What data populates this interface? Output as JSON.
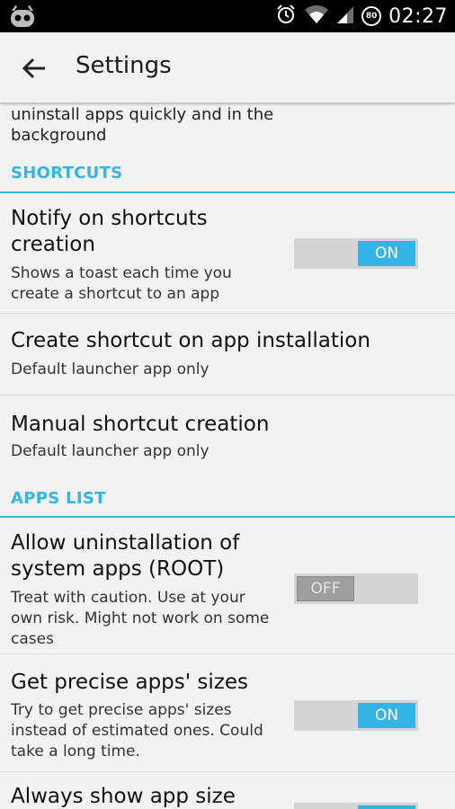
{
  "status_bar": {
    "time": "02:27",
    "battery_level": "80",
    "icons": [
      "android-head-icon",
      "alarm-icon",
      "wifi-icon",
      "signal-icon",
      "battery-circle-icon"
    ]
  },
  "action_bar": {
    "title": "Settings",
    "back_icon": "arrow-back-icon"
  },
  "top_summary": "uninstall apps quickly and in the background",
  "sections": {
    "shortcuts": "SHORTCUTS",
    "apps_list": "APPS LIST"
  },
  "prefs": {
    "notify": {
      "title": "Notify on shortcuts creation",
      "summary": "Shows a toast each time you create a shortcut to an app",
      "switch_label": "ON",
      "state": "on"
    },
    "create_on_install": {
      "title": "Create shortcut on app installation",
      "summary": "Default launcher app only"
    },
    "manual": {
      "title": "Manual shortcut creation",
      "summary": "Default launcher app only"
    },
    "uninstall_system": {
      "title": "Allow uninstallation of system apps (ROOT)",
      "summary": "Treat with caution. Use at your own risk. Might not work on some cases",
      "switch_label": "OFF",
      "state": "off"
    },
    "precise_sizes": {
      "title": "Get precise apps' sizes",
      "summary": "Try to get precise apps' sizes instead of estimated ones. Could take a long time.",
      "switch_label": "ON",
      "state": "on"
    },
    "always_show_size": {
      "title": "Always show app size",
      "state": "on"
    }
  },
  "colors": {
    "accent": "#33b5e5",
    "background": "#f2f2f2",
    "status_bar": "#000000"
  }
}
